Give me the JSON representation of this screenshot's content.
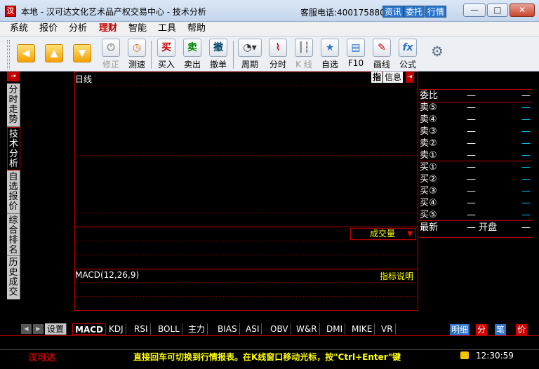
{
  "window": {
    "title": "本地 - 汉可达文化艺术品产权交易中心 - 技术分析",
    "hotline": "客服电话:4001758808",
    "links": [
      "资讯",
      "委托",
      "行情"
    ],
    "controls": {
      "minimize": "—",
      "maximize": "□",
      "close": "✕"
    }
  },
  "menu": [
    {
      "label": "系统",
      "active": false
    },
    {
      "label": "报价",
      "active": false
    },
    {
      "label": "分析",
      "active": false
    },
    {
      "label": "理财",
      "active": true
    },
    {
      "label": "智能",
      "active": false
    },
    {
      "label": "工具",
      "active": false
    },
    {
      "label": "帮助",
      "active": false
    }
  ],
  "toolbar": {
    "fix": "修正",
    "test_speed": "测速",
    "buy": "买入",
    "sell": "卖出",
    "cancel": "撤单",
    "period": "周期",
    "timeshare": "分时",
    "kline": "K 线",
    "watchlist": "自选",
    "f10": "F10",
    "draw": "画线",
    "formula": "公式",
    "buy_glyph": "买",
    "sell_glyph": "卖",
    "cancel_glyph": "撤"
  },
  "left_tabs": [
    "分时走势",
    "技术分析",
    "自选报价",
    "综合排名",
    "历史成交"
  ],
  "chart": {
    "title": "日线",
    "tag_index": "指",
    "tag_info": "信息",
    "volume_select": "成交量",
    "macd_label": "MACD(12,26,9)",
    "indicator_help": "指标说明"
  },
  "quote": {
    "rows": [
      {
        "label": "委比",
        "v1": "—",
        "v2": "—"
      },
      {
        "label": "卖⑤",
        "v1": "—",
        "v2": "—"
      },
      {
        "label": "卖④",
        "v1": "—",
        "v2": "—"
      },
      {
        "label": "卖③",
        "v1": "—",
        "v2": "—"
      },
      {
        "label": "卖②",
        "v1": "—",
        "v2": "—"
      },
      {
        "label": "卖①",
        "v1": "—",
        "v2": "—"
      },
      {
        "label": "买①",
        "v1": "—",
        "v2": "—"
      },
      {
        "label": "买②",
        "v1": "—",
        "v2": "—"
      },
      {
        "label": "买③",
        "v1": "—",
        "v2": "—"
      },
      {
        "label": "买④",
        "v1": "—",
        "v2": "—"
      },
      {
        "label": "买⑤",
        "v1": "—",
        "v2": "—"
      },
      {
        "label": "最新",
        "v1": "— 开盘",
        "v2": "—"
      }
    ]
  },
  "indicator_tabs": [
    "设置",
    "MACD",
    "KDJ",
    "RSI",
    "BOLL",
    "主力",
    "BIAS",
    "ASI",
    "OBV",
    "W&R",
    "DMI",
    "MIKE",
    "VR"
  ],
  "right_tabs": [
    "明细",
    "分",
    "笔",
    "价"
  ],
  "status": {
    "logo": "汉可达",
    "tip": "直接回车可切换到行情报表。在K线窗口移动光标，按\"Ctrl+Enter\"键",
    "time": "12:30:59"
  }
}
